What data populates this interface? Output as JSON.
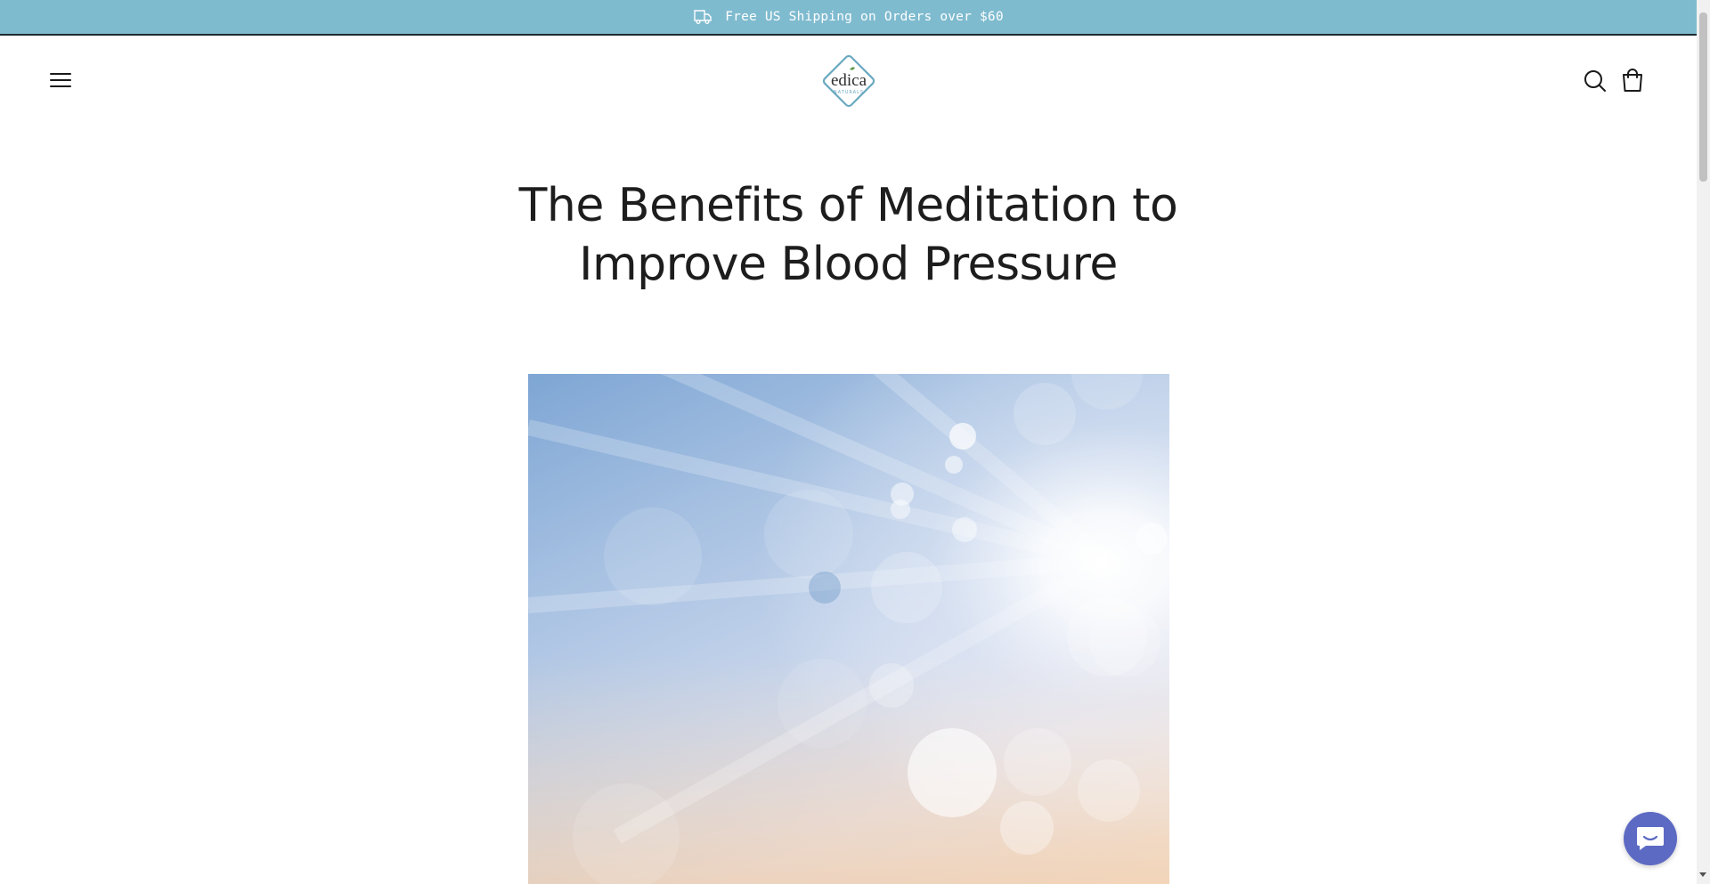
{
  "announcement": {
    "text": "Free US Shipping on Orders over $60",
    "icon": "truck-icon",
    "background": "#7fbbcf"
  },
  "header": {
    "menu_icon": "menu-icon",
    "logo": {
      "brand": "edica",
      "tagline": "NATURALS",
      "accent": "#6aa9c0"
    },
    "search_icon": "search-icon",
    "cart_icon": "cart-icon"
  },
  "article": {
    "title": "The Benefits of Meditation to Improve Blood Pressure",
    "hero_image": "sky-sunburst-bokeh"
  },
  "chat": {
    "icon": "chat-icon",
    "color": "#5c6ac4"
  }
}
